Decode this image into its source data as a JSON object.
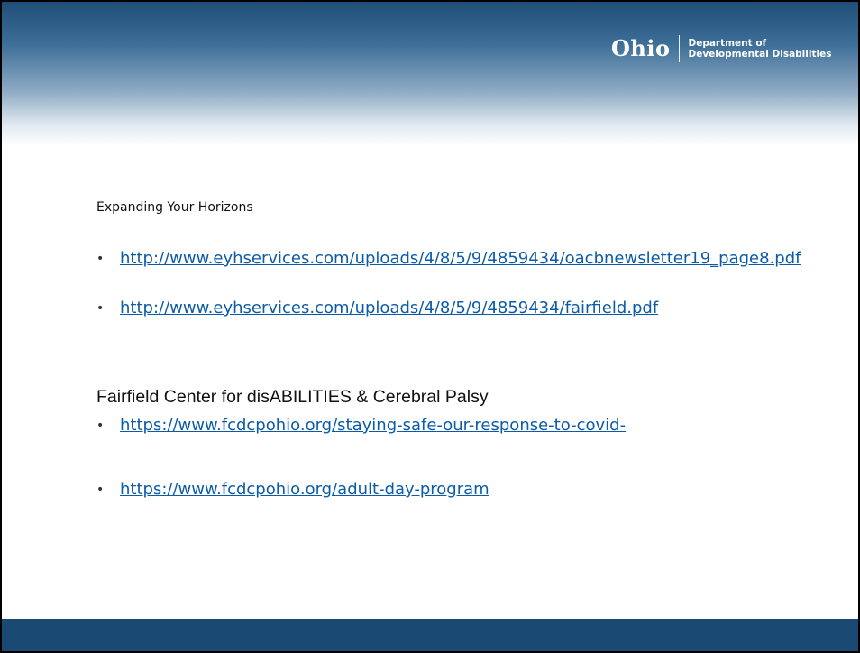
{
  "logo": {
    "wordmark": "Ohio",
    "dept_line1": "Department of",
    "dept_line2": "Developmental Disabilities"
  },
  "section1": {
    "heading": "Expanding Your Horizons",
    "links": [
      "http://www.eyhservices.com/uploads/4/8/5/9/4859434/oacbnewsletter19_page8.pdf",
      "http://www.eyhservices.com/uploads/4/8/5/9/4859434/fairfield.pdf"
    ]
  },
  "section2": {
    "heading": "Fairfield Center for disABILITIES & Cerebral Palsy",
    "links": [
      "https://www.fcdcpohio.org/staying-safe-our-response-to-covid-",
      "https://www.fcdcpohio.org/adult-day-program"
    ]
  },
  "bullet": "•",
  "colors": {
    "header_top": "#1f4e79",
    "footer": "#1a4a73",
    "link": "#0b5ba8"
  }
}
